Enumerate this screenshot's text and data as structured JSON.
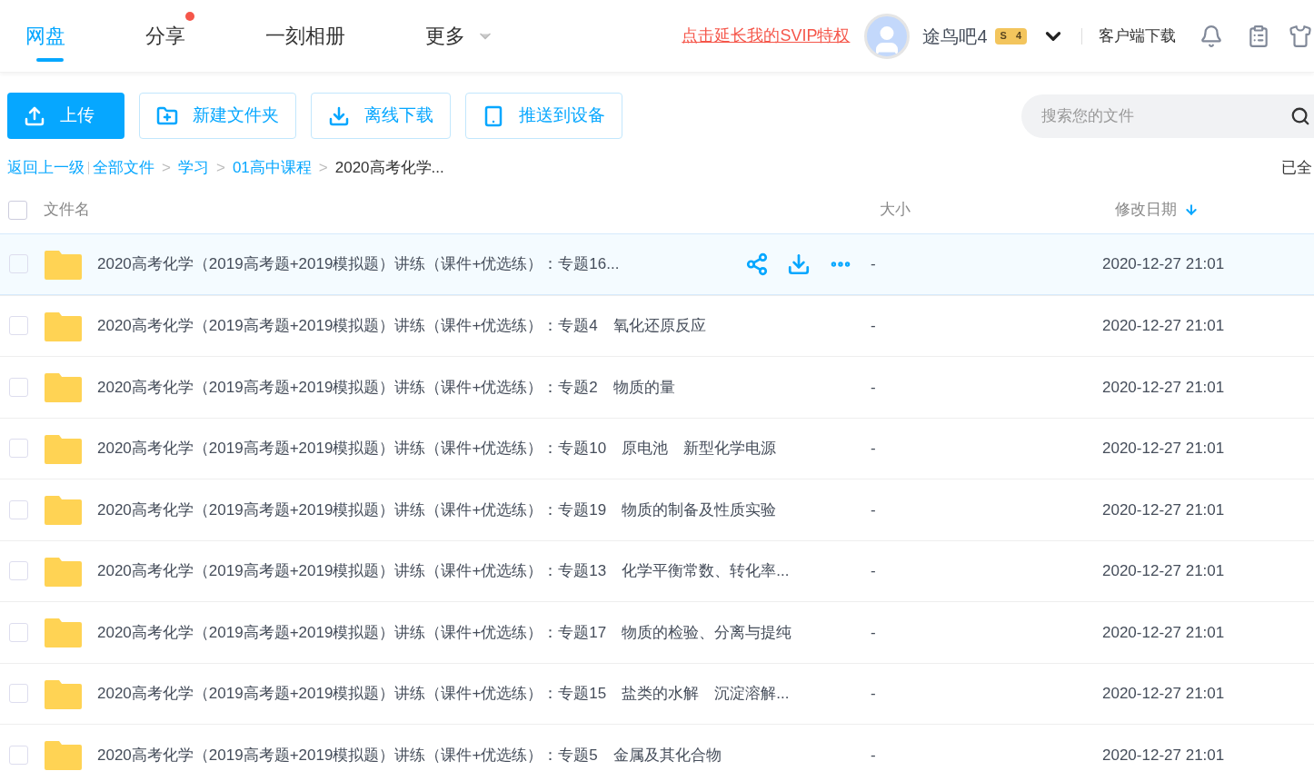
{
  "nav": {
    "tabs": [
      {
        "label": "网盘",
        "selected": true,
        "dot": false,
        "caret": false
      },
      {
        "label": "分享",
        "selected": false,
        "dot": true,
        "caret": false
      },
      {
        "label": "一刻相册",
        "selected": false,
        "dot": false,
        "caret": false
      },
      {
        "label": "更多",
        "selected": false,
        "dot": false,
        "caret": true
      }
    ],
    "promo_link": "点击延长我的SVIP特权",
    "username": "途鸟吧4",
    "vip_badge": {
      "symbol": "S",
      "level": "4"
    },
    "client_download": "客户端下载"
  },
  "toolbar": {
    "buttons": [
      {
        "label": "上传",
        "kind": "upload",
        "primary": true
      },
      {
        "label": "新建文件夹",
        "kind": "folder",
        "primary": false
      },
      {
        "label": "离线下载",
        "kind": "download",
        "primary": false
      },
      {
        "label": "推送到设备",
        "kind": "device",
        "primary": false
      }
    ],
    "search": {
      "placeholder": "搜索您的文件"
    }
  },
  "breadcrumb": {
    "back": "返回上一级",
    "separator": ">",
    "items": [
      "全部文件",
      "学习",
      "01高中课程"
    ],
    "current": "2020高考化学...",
    "loaded_note": "已全"
  },
  "table": {
    "columns": [
      "文件名",
      "大小",
      "修改日期"
    ],
    "sort_arrow": true,
    "select_all": {
      "checked": false
    },
    "rows": [
      {
        "name": "2020高考化学（2019高考题+2019模拟题）讲练（课件+优选练）：专题16...",
        "size": "-",
        "date": "2020-12-27 21:01",
        "highlighted": true,
        "checked": false
      },
      {
        "name": "2020高考化学（2019高考题+2019模拟题）讲练（课件+优选练）：专题4　氧化还原反应",
        "size": "-",
        "date": "2020-12-27 21:01",
        "highlighted": false,
        "checked": false
      },
      {
        "name": "2020高考化学（2019高考题+2019模拟题）讲练（课件+优选练）：专题2　物质的量",
        "size": "-",
        "date": "2020-12-27 21:01",
        "highlighted": false,
        "checked": false
      },
      {
        "name": "2020高考化学（2019高考题+2019模拟题）讲练（课件+优选练）：专题10　原电池　新型化学电源",
        "size": "-",
        "date": "2020-12-27 21:01",
        "highlighted": false,
        "checked": false
      },
      {
        "name": "2020高考化学（2019高考题+2019模拟题）讲练（课件+优选练）：专题19　物质的制备及性质实验",
        "size": "-",
        "date": "2020-12-27 21:01",
        "highlighted": false,
        "checked": false
      },
      {
        "name": "2020高考化学（2019高考题+2019模拟题）讲练（课件+优选练）：专题13　化学平衡常数、转化率...",
        "size": "-",
        "date": "2020-12-27 21:01",
        "highlighted": false,
        "checked": false
      },
      {
        "name": "2020高考化学（2019高考题+2019模拟题）讲练（课件+优选练）：专题17　物质的检验、分离与提纯",
        "size": "-",
        "date": "2020-12-27 21:01",
        "highlighted": false,
        "checked": false
      },
      {
        "name": "2020高考化学（2019高考题+2019模拟题）讲练（课件+优选练）：专题15　盐类的水解　沉淀溶解...",
        "size": "-",
        "date": "2020-12-27 21:01",
        "highlighted": false,
        "checked": false
      },
      {
        "name": "2020高考化学（2019高考题+2019模拟题）讲练（课件+优选练）：专题5　金属及其化合物",
        "size": "-",
        "date": "2020-12-27 21:01",
        "highlighted": false,
        "checked": false
      }
    ]
  }
}
